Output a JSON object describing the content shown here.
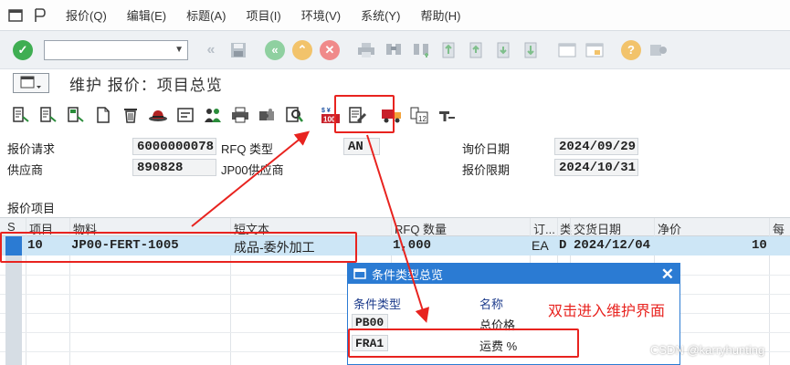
{
  "menubar": {
    "items": [
      "报价(Q)",
      "编辑(E)",
      "标题(A)",
      "项目(I)",
      "环境(V)",
      "系统(Y)",
      "帮助(H)"
    ]
  },
  "toolbar": {
    "command_value": ""
  },
  "titlebar": {
    "title": "维护 报价：项目总览"
  },
  "header": {
    "req_label": "报价请求",
    "req_value": "6000000078",
    "rfq_type_label": "RFQ 类型",
    "rfq_type_value": "AN",
    "inquiry_date_label": "询价日期",
    "inquiry_date_value": "2024/09/29",
    "vendor_label": "供应商",
    "vendor_value": "890828",
    "vendor_name": "JP00供应商",
    "deadline_label": "报价限期",
    "deadline_value": "2024/10/31"
  },
  "table": {
    "section_title": "报价项目",
    "headers": [
      "S",
      "项目",
      "物料",
      "短文本",
      "RFQ 数量",
      "订...",
      "类",
      "交货日期",
      "净价",
      "每"
    ],
    "rows": [
      {
        "item": "10",
        "material": "JP00-FERT-1005",
        "short_text": "成品-委外加工",
        "qty": "1,000",
        "unit": "EA",
        "cat": "D",
        "date": "2024/12/04",
        "net_price": "10"
      }
    ]
  },
  "dialog": {
    "title": "条件类型总览",
    "col_type": "条件类型",
    "col_name": "名称",
    "rows": [
      {
        "code": "PB00",
        "name": "总价格"
      },
      {
        "code": "FRA1",
        "name": "运费 %"
      }
    ]
  },
  "annotation": {
    "text": "双击进入维护界面"
  },
  "watermark": "CSDN @karryhunting",
  "colors": {
    "accent": "#2b7bd3",
    "annotation": "#e8231f",
    "selection": "#cde6f6"
  }
}
